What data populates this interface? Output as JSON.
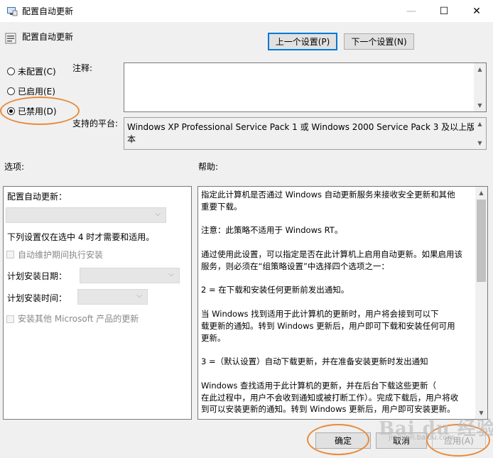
{
  "window": {
    "title": "配置自动更新",
    "icon": "policy-window-icon",
    "minimize_glyph": "—",
    "maximize_glyph": "☐",
    "close_glyph": "✕"
  },
  "header": {
    "policy_name": "配置自动更新",
    "prev_button": "上一个设置(P)",
    "next_button": "下一个设置(N)"
  },
  "state": {
    "options": [
      "未配置(C)",
      "已启用(E)",
      "已禁用(D)"
    ],
    "selected": "已禁用(D)"
  },
  "comment": {
    "label": "注释:",
    "value": ""
  },
  "platform": {
    "label": "支持的平台:",
    "value_line1": "Windows XP Professional Service Pack 1 或 Windows 2000 Service Pack 3 及以上版",
    "value_line2": "本"
  },
  "options_panel": {
    "label": "选项:",
    "configure_label": "配置自动更新：",
    "note": "下列设置仅在选中 4 时才需要和适用。",
    "maintenance_checkbox": "自动维护期间执行安装",
    "schedule_day_label": "计划安装日期：",
    "schedule_time_label": "计划安装时间：",
    "other_products_checkbox": "安装其他 Microsoft 产品的更新"
  },
  "help_panel": {
    "label": "帮助:",
    "lines": [
      "指定此计算机是否通过 Windows 自动更新服务来接收安全更新和其他",
      "重要下载。",
      "",
      "注意：此策略不适用于 Windows RT。",
      "",
      "通过使用此设置，可以指定是否在此计算机上启用自动更新。如果启用该",
      "服务，则必须在“组策略设置”中选择四个选项之一：",
      "",
      "        2 = 在下载和安装任何更新前发出通知。",
      "",
      "        当 Windows 找到适用于此计算机的更新时，用户将会接到可以下",
      "载更新的通知。转到 Windows 更新后，用户即可下载和安装任何可用",
      "更新。",
      "",
      "        3 =（默认设置）自动下载更新，并在准备安装更新时发出通知",
      "",
      "        Windows 查找适用于此计算机的更新，并在后台下载这些更新（",
      "在此过程中，用户不会收到通知或被打断工作）。完成下载后，用户将收",
      "到可以安装更新的通知。转到 Windows 更新后，用户即可安装更新。"
    ]
  },
  "footer": {
    "ok": "确定",
    "cancel": "取消",
    "apply": "应用(A)"
  },
  "watermark": {
    "text": "Bai du 经验",
    "sub": "jingyan.baidu.com"
  },
  "colors": {
    "accent": "#0078d7",
    "highlight": "#e98a3b"
  }
}
